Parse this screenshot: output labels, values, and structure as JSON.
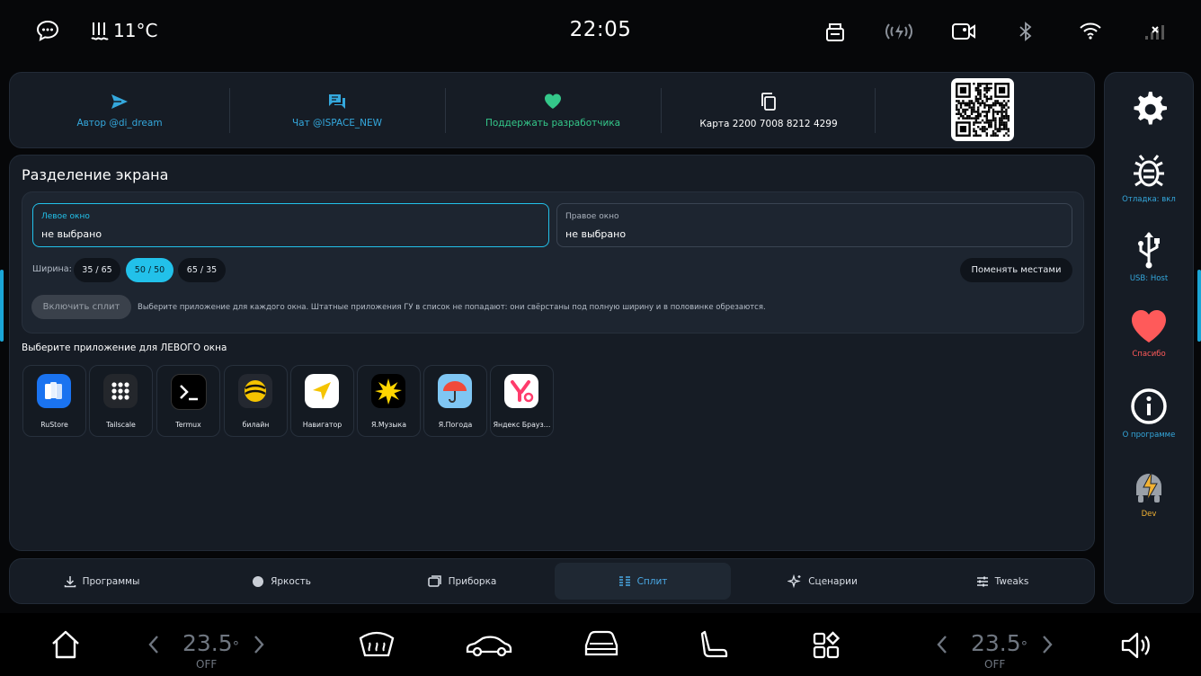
{
  "status": {
    "temperature": "11°C",
    "time": "22:05"
  },
  "links": [
    {
      "label": "Автор @di_dream",
      "color": "#34a8dd",
      "icon": "send-icon"
    },
    {
      "label": "Чат @ISPACE_NEW",
      "color": "#34a8dd",
      "icon": "chat-icon"
    },
    {
      "label": "Поддержать разработчика",
      "color": "#34c88a",
      "icon": "heart-icon"
    },
    {
      "label": "Карта 2200 7008 8212 4299",
      "color": "#ffffff",
      "icon": "copy-icon"
    }
  ],
  "split": {
    "title": "Разделение экрана",
    "left": {
      "label": "Левое окно",
      "value": "не выбрано"
    },
    "right": {
      "label": "Правое окно",
      "value": "не выбрано"
    },
    "width_label": "Ширина:",
    "widths": [
      "35 / 65",
      "50 / 50",
      "65 / 35"
    ],
    "selected_width": "50 / 50",
    "swap_label": "Поменять местами",
    "enable_label": "Включить сплит",
    "hint": "Выберите приложение для каждого окна. Штатные приложения ГУ в список не попадают: они свёрстаны под полную ширину и в половинке обрезаются.",
    "section_title": "Выберите приложение для ЛЕВОГО окна"
  },
  "apps": [
    {
      "name": "RuStore"
    },
    {
      "name": "Tailscale"
    },
    {
      "name": "Termux"
    },
    {
      "name": "билайн"
    },
    {
      "name": "Навигатор"
    },
    {
      "name": "Я.Музыка"
    },
    {
      "name": "Я.Погода"
    },
    {
      "name": "Яндекс Брауз…"
    }
  ],
  "tabs": [
    {
      "label": "Программы",
      "icon": "download-icon"
    },
    {
      "label": "Яркость",
      "icon": "brightness-icon"
    },
    {
      "label": "Приборка",
      "icon": "dashboard-icon"
    },
    {
      "label": "Сплит",
      "icon": "split-icon",
      "active": true
    },
    {
      "label": "Сценарии",
      "icon": "sparkle-icon"
    },
    {
      "label": "Tweaks",
      "icon": "sliders-icon"
    }
  ],
  "sidebar": [
    {
      "label": "",
      "icon": "gear-icon"
    },
    {
      "label": "Отладка: вкл",
      "icon": "bug-icon",
      "color": "#34a8dd"
    },
    {
      "label": "USB: Host",
      "icon": "usb-icon",
      "color": "#34a8dd"
    },
    {
      "label": "Спасибо",
      "icon": "heart-icon",
      "color": "#ff5a5a"
    },
    {
      "label": "О программе",
      "icon": "info-icon",
      "color": "#34a8dd"
    },
    {
      "label": "Dev",
      "icon": "android-bolt-icon",
      "color": "#f2b233"
    }
  ],
  "climate": {
    "left": {
      "value": "23.5",
      "unit": "°",
      "state": "OFF"
    },
    "right": {
      "value": "23.5",
      "unit": "°",
      "state": "OFF"
    }
  }
}
